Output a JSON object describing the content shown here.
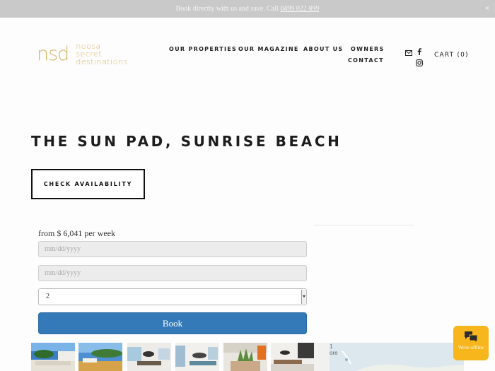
{
  "announcement": {
    "text": "Book directly with us and save. Call ",
    "phone": "0499 022 899",
    "close_label": "×"
  },
  "logo": {
    "mark": "nsd",
    "line1": "noosa",
    "line2": "secret",
    "line3": "destinations"
  },
  "nav": {
    "our_properties": "OUR PROPERTIES",
    "our_magazine": "OUR MAGAZINE",
    "about_us": "ABOUT US",
    "owners": "OWNERS",
    "contact": "CONTACT",
    "cart": "CART (0)"
  },
  "icons": {
    "email": "email-icon",
    "facebook": "facebook-icon",
    "instagram": "instagram-icon",
    "chat": "chat-icon"
  },
  "property": {
    "title": "THE SUN PAD, SUNRISE BEACH",
    "check_availability": "CHECK AVAILABILITY",
    "price": "from $ 6,041 per week"
  },
  "booking": {
    "checkin_placeholder": "mm/dd/yyyy",
    "checkout_placeholder": "mm/dd/yyyy",
    "guests": "2",
    "book_label": "Book"
  },
  "map": {
    "label_line1": "1",
    "label_line2": "ore"
  },
  "chat": {
    "status": "We're offline"
  },
  "colors": {
    "gold": "#d7b869",
    "book_blue": "#3479b8",
    "chat_yellow": "#f6b61c"
  }
}
